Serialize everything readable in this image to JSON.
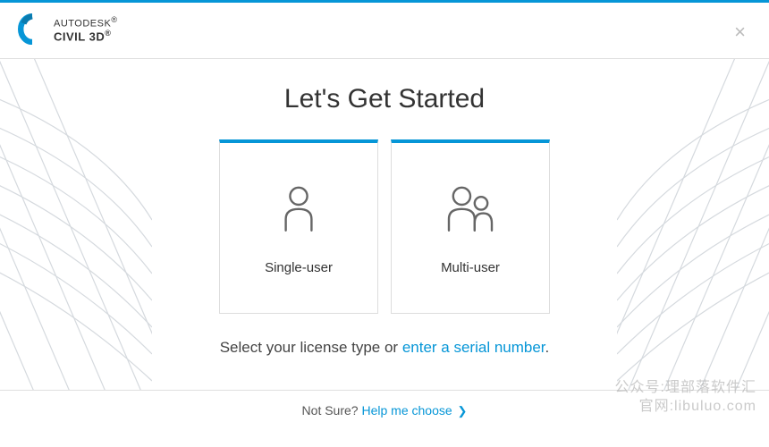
{
  "header": {
    "brand_line1": "AUTODESK",
    "brand_line2": "CIVIL 3D",
    "reg_mark": "®",
    "close_symbol": "×"
  },
  "main": {
    "title": "Let's Get Started",
    "cards": [
      {
        "label": "Single-user"
      },
      {
        "label": "Multi-user"
      }
    ],
    "select_prefix": "Select your license type or ",
    "select_link": "enter a serial number",
    "select_suffix": "."
  },
  "footer": {
    "prefix": "Not Sure? ",
    "link": "Help me choose",
    "chevron": "❯"
  },
  "watermark": {
    "line1": "公众号:理部落软件汇",
    "line2": "官网:libuluo.com"
  },
  "colors": {
    "accent": "#0696D7",
    "icon_stroke": "#666666"
  }
}
